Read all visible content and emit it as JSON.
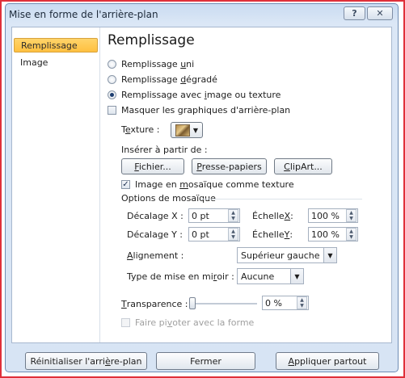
{
  "window": {
    "title": "Mise en forme de l'arrière-plan",
    "help_symbol": "?",
    "close_symbol": "✕"
  },
  "sidebar": {
    "items": [
      {
        "label": "Remplissage",
        "selected": true
      },
      {
        "label": "Image",
        "selected": false
      }
    ]
  },
  "fill": {
    "heading": "Remplissage",
    "options": [
      {
        "pre": "Remplissage ",
        "key": "u",
        "post": "ni",
        "checked": false
      },
      {
        "pre": "Remplissage ",
        "key": "d",
        "post": "égradé",
        "checked": false
      },
      {
        "pre": "Remplissage avec ",
        "key": "i",
        "post": "mage ou texture",
        "checked": true
      }
    ],
    "hide_graphics": {
      "label": "Masquer les graphiques d'arrière-plan",
      "checked": false
    },
    "texture_label_pre": "T",
    "texture_label_key": "e",
    "texture_label_post": "xture :",
    "insert_from_label": "Insérer à partir de :",
    "file_button_key": "F",
    "file_button_post": "ichier...",
    "clipboard_button_key": "P",
    "clipboard_button_post": "resse-papiers",
    "clipart_button_key": "C",
    "clipart_button_post": "lipArt...",
    "tile_checkbox": {
      "pre": "Image en ",
      "key": "m",
      "post": "osaïque comme texture",
      "checked": true
    },
    "tiling_options_label": "Options de mosaïque",
    "offset_x_label": "Décalage X :",
    "offset_x_value": "0 pt",
    "scale_x_pre": "Échelle ",
    "scale_x_key": "X",
    "scale_x_post": " :",
    "scale_x_value": "100 %",
    "offset_y_pre": "Décala",
    "offset_y_key": "g",
    "offset_y_post": "e Y :",
    "offset_y_value": "0 pt",
    "scale_y_pre": "Échelle ",
    "scale_y_key": "Y",
    "scale_y_post": " :",
    "scale_y_value": "100 %",
    "alignment_key": "A",
    "alignment_post": "lignement :",
    "alignment_value": "Supérieur gauche",
    "mirror_pre": "Type de mise en mi",
    "mirror_key": "r",
    "mirror_post": "oir :",
    "mirror_value": "Aucune",
    "transparency_key": "T",
    "transparency_post": "ransparence :",
    "transparency_value": "0 %",
    "transparency_level": 0,
    "rotate_checkbox": {
      "pre": "Faire pi",
      "key": "v",
      "post": "oter avec la forme",
      "checked": false,
      "disabled": true
    }
  },
  "footer": {
    "reset_pre": "Réinitialiser l'arri",
    "reset_key": "è",
    "reset_post": "re-plan",
    "close_label": "Fermer",
    "apply_all_key": "A",
    "apply_all_post": "ppliquer partout"
  }
}
